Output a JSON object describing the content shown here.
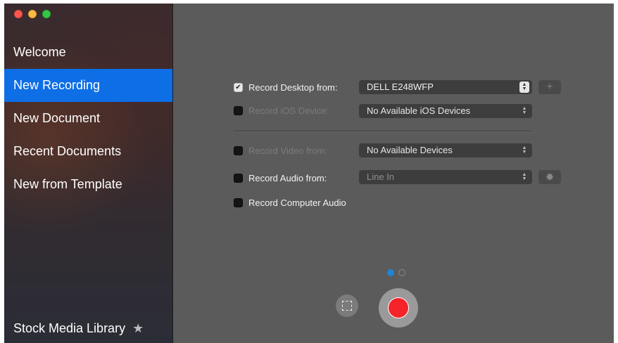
{
  "sidebar": {
    "items": [
      {
        "label": "Welcome",
        "selected": false
      },
      {
        "label": "New Recording",
        "selected": true
      },
      {
        "label": "New Document",
        "selected": false
      },
      {
        "label": "Recent Documents",
        "selected": false
      },
      {
        "label": "New from Template",
        "selected": false
      }
    ],
    "stock_label": "Stock Media Library",
    "stock_icon": "star-icon",
    "selected_color": "#0d6ee6"
  },
  "options": {
    "desktop": {
      "label": "Record Desktop from:",
      "checked": true,
      "enabled": true,
      "value": "DELL E248WFP"
    },
    "ios": {
      "label": "Record iOS Device:",
      "checked": false,
      "enabled": false,
      "value": "No Available iOS Devices"
    },
    "video": {
      "label": "Record Video from:",
      "checked": false,
      "enabled": false,
      "value": "No Available Devices"
    },
    "audio": {
      "label": "Record Audio from:",
      "checked": false,
      "enabled": true,
      "value": "Line In"
    },
    "computer_audio": {
      "label": "Record Computer Audio",
      "checked": false,
      "enabled": true
    }
  },
  "icons": {
    "add_display": "plus-icon",
    "audio_settings": "gear-icon",
    "region": "selection-region-icon",
    "record": "record-icon"
  },
  "pager": {
    "pages": 2,
    "current": 1
  },
  "colors": {
    "record": "#f5232a",
    "pager_active": "#1c86d6",
    "background": "#5b5b5b"
  }
}
